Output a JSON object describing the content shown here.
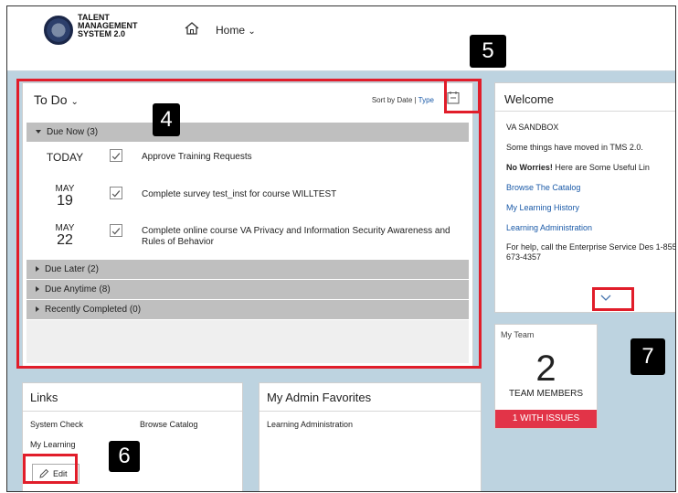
{
  "header": {
    "brand_lines": [
      "TALENT",
      "MANAGEMENT",
      "SYSTEM 2.0"
    ],
    "home_label": "Home"
  },
  "todo": {
    "title": "To Do",
    "sort_label": "Sort by Date |",
    "sort_type": "Type",
    "groups": {
      "due_now": "Due Now (3)",
      "due_later": "Due Later (2)",
      "due_anytime": "Due Anytime (8)",
      "recently_completed": "Recently Completed (0)"
    },
    "tasks": [
      {
        "date_single": "TODAY",
        "text": "Approve Training Requests"
      },
      {
        "month": "MAY",
        "day": "19",
        "text": "Complete survey test_inst for course WILLTEST"
      },
      {
        "month": "MAY",
        "day": "22",
        "text": "Complete online course VA Privacy and Information Security Awareness and Rules of Behavior"
      }
    ]
  },
  "welcome": {
    "title": "Welcome",
    "org": "VA SANDBOX",
    "moved": "Some things have moved in TMS 2.0.",
    "no_worries_bold": "No Worries!",
    "no_worries_rest": " Here are Some Useful Lin",
    "links": [
      "Browse The Catalog",
      "My Learning History",
      "Learning Administration"
    ],
    "help": "For help, call the Enterprise Service Des 1-855-673-4357"
  },
  "my_team": {
    "title": "My Team",
    "count": "2",
    "label": "TEAM MEMBERS",
    "issues": "1 WITH ISSUES"
  },
  "links_panel": {
    "title": "Links",
    "items": [
      "System Check",
      "Browse Catalog",
      "My Learning"
    ],
    "edit_label": "Edit"
  },
  "admin_favorites": {
    "title": "My Admin Favorites",
    "items": [
      "Learning Administration"
    ]
  },
  "callouts": {
    "badge_4": "4",
    "badge_5": "5",
    "badge_6": "6",
    "badge_7": "7",
    "color": "#e11d2a"
  },
  "icons": [
    "va-seal-icon",
    "home-icon",
    "chevron-down-icon",
    "calendar-icon",
    "checkbox-checked-icon",
    "pencil-icon",
    "triangle-expand-icon"
  ]
}
